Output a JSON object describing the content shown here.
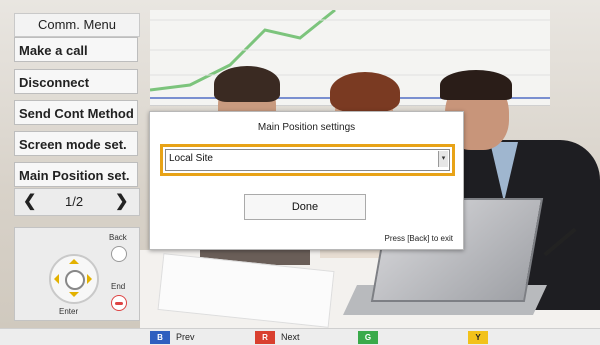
{
  "menu": {
    "title": "Comm. Menu",
    "items": [
      {
        "label": "Make a call"
      },
      {
        "label": "Disconnect"
      },
      {
        "label": "Send Cont Method"
      },
      {
        "label": "Screen mode set."
      },
      {
        "label": "Main Position set."
      }
    ],
    "pager": {
      "prev_icon": "chevron-left-icon",
      "page": "1/2",
      "next_icon": "chevron-right-icon"
    }
  },
  "remote": {
    "back_label": "Back",
    "end_label": "End",
    "enter_label": "Enter"
  },
  "dialog": {
    "title": "Main Position settings",
    "select_value": "Local Site",
    "done_label": "Done",
    "hint": "Press [Back] to exit"
  },
  "bottom_bar": {
    "keys": [
      {
        "key": "B",
        "label": "Prev",
        "color": "#2f5fbf"
      },
      {
        "key": "R",
        "label": "Next",
        "color": "#d9402f"
      },
      {
        "key": "G",
        "label": "",
        "color": "#3aaa4a"
      },
      {
        "key": "Y",
        "label": "",
        "color": "#f2c21b"
      }
    ]
  },
  "colors": {
    "highlight": "#e8a317"
  }
}
